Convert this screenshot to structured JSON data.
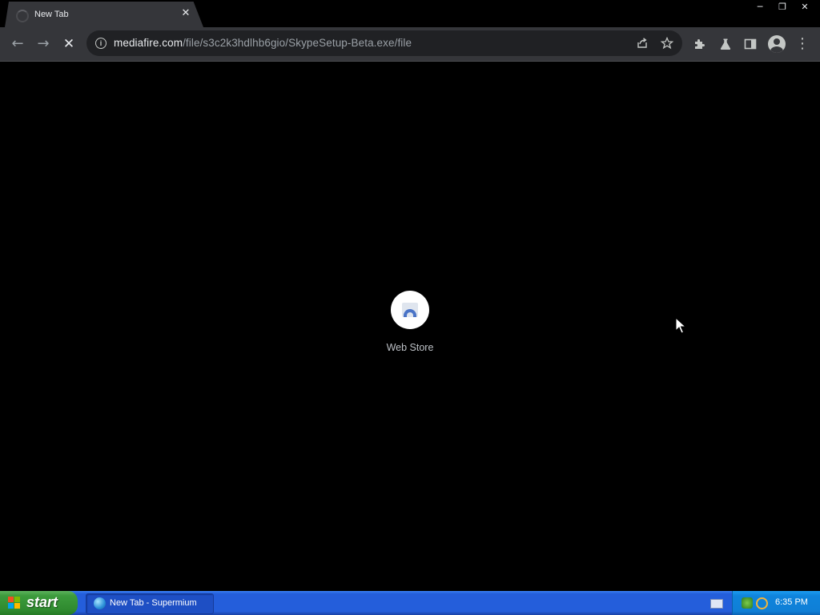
{
  "tab": {
    "title": "New Tab",
    "close_glyph": "✕"
  },
  "window_controls": {
    "minimize": "─",
    "restore": "❐",
    "close": "✕"
  },
  "toolbar": {
    "back_glyph": "←",
    "forward_glyph": "→",
    "stop_glyph": "✕",
    "url_host": "mediafire.com",
    "url_path": "/file/s3c2k3hdlhb6gio/SkypeSetup-Beta.exe/file",
    "menu_glyph": "⋮"
  },
  "content": {
    "shortcut_label": "Web Store"
  },
  "taskbar": {
    "start_label": "start",
    "task_label": "New Tab - Supermium",
    "clock": "6:35 PM"
  },
  "colors": {
    "toolbar_bg": "#35363a",
    "page_bg": "#000000",
    "taskbar_blue": "#245edb",
    "start_green": "#3c9b3c"
  }
}
